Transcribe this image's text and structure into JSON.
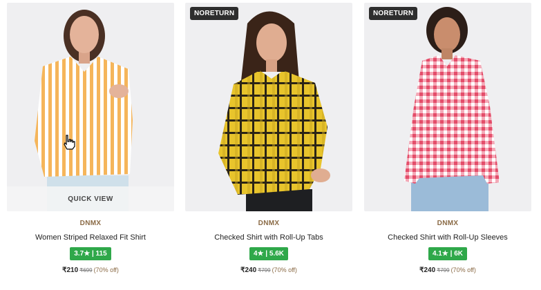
{
  "products": [
    {
      "badge": "",
      "quick_view": "QUICK VIEW",
      "brand": "DNMX",
      "name": "Women Striped Relaxed Fit Shirt",
      "rating": "3.7",
      "reviews": "115",
      "price": "₹210",
      "mrp": "₹699",
      "discount": "(70% off)"
    },
    {
      "badge": "NORETURN",
      "brand": "DNMX",
      "name": "Checked Shirt with Roll-Up Tabs",
      "rating": "4",
      "reviews": "5.6K",
      "price": "₹240",
      "mrp": "₹799",
      "discount": "(70% off)"
    },
    {
      "badge": "NORETURN",
      "brand": "DNMX",
      "name": "Checked Shirt with Roll-Up Sleeves",
      "rating": "4.1",
      "reviews": "6K",
      "price": "₹240",
      "mrp": "₹799",
      "discount": "(70% off)"
    }
  ],
  "rating_star": "★",
  "rating_separator": "|",
  "colors": {
    "rating_green": "#2fa84a",
    "brand_brown": "#8a6a45",
    "badge_dark": "#2e2e2e"
  }
}
